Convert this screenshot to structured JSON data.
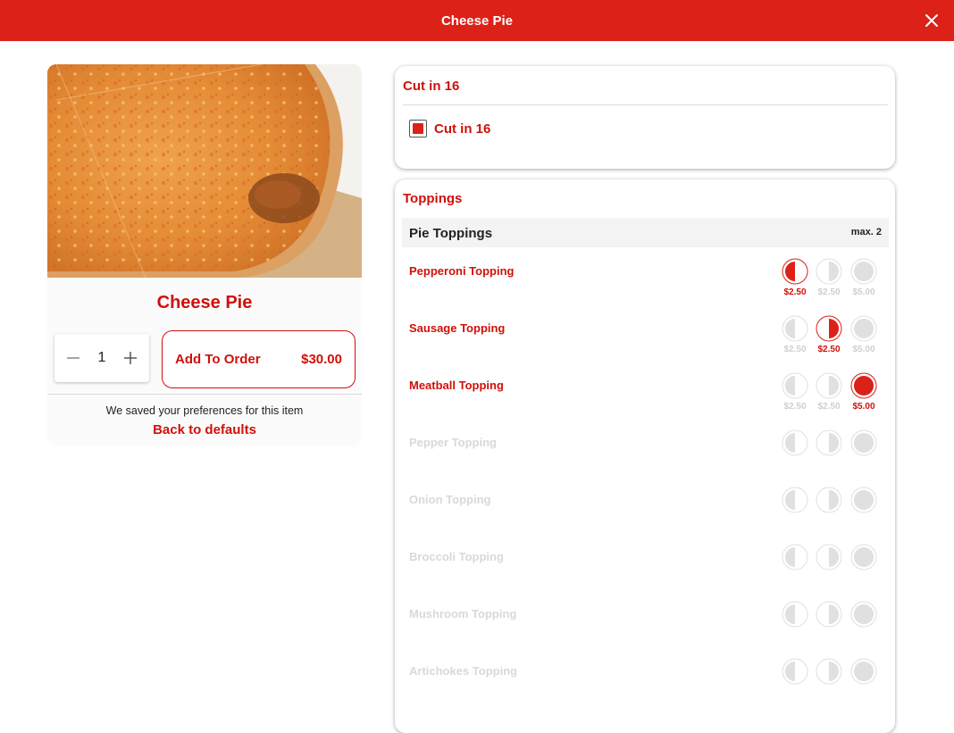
{
  "header": {
    "title": "Cheese Pie"
  },
  "item": {
    "title": "Cheese Pie",
    "quantity": "1",
    "add_label": "Add To Order",
    "price": "$30.00",
    "saved_text": "We saved your preferences for this item",
    "defaults_link": "Back to defaults"
  },
  "cut_section": {
    "title": "Cut in 16",
    "option_label": "Cut in 16",
    "checked": true
  },
  "toppings_section": {
    "title": "Toppings",
    "group_name": "Pie Toppings",
    "group_max": "max. 2",
    "items": [
      {
        "name": "Pepperoni Topping",
        "enabled": true,
        "selected": "left",
        "prices": {
          "left": "$2.50",
          "right": "$2.50",
          "whole": "$5.00"
        }
      },
      {
        "name": "Sausage Topping",
        "enabled": true,
        "selected": "right",
        "prices": {
          "left": "$2.50",
          "right": "$2.50",
          "whole": "$5.00"
        }
      },
      {
        "name": "Meatball Topping",
        "enabled": true,
        "selected": "whole",
        "prices": {
          "left": "$2.50",
          "right": "$2.50",
          "whole": "$5.00"
        }
      },
      {
        "name": "Pepper Topping",
        "enabled": false,
        "selected": "",
        "prices": {
          "left": "",
          "right": "",
          "whole": ""
        }
      },
      {
        "name": "Onion Topping",
        "enabled": false,
        "selected": "",
        "prices": {
          "left": "",
          "right": "",
          "whole": ""
        }
      },
      {
        "name": "Broccoli Topping",
        "enabled": false,
        "selected": "",
        "prices": {
          "left": "",
          "right": "",
          "whole": ""
        }
      },
      {
        "name": "Mushroom Topping",
        "enabled": false,
        "selected": "",
        "prices": {
          "left": "",
          "right": "",
          "whole": ""
        }
      },
      {
        "name": "Artichokes Topping",
        "enabled": false,
        "selected": "",
        "prices": {
          "left": "",
          "right": "",
          "whole": ""
        }
      }
    ]
  },
  "colors": {
    "brand": "#dc2118",
    "text_red": "#d0100a",
    "disabled_text": "#d9d9d9",
    "inactive_price": "#cfcfcf",
    "option_gray": "#e0e0e0"
  }
}
